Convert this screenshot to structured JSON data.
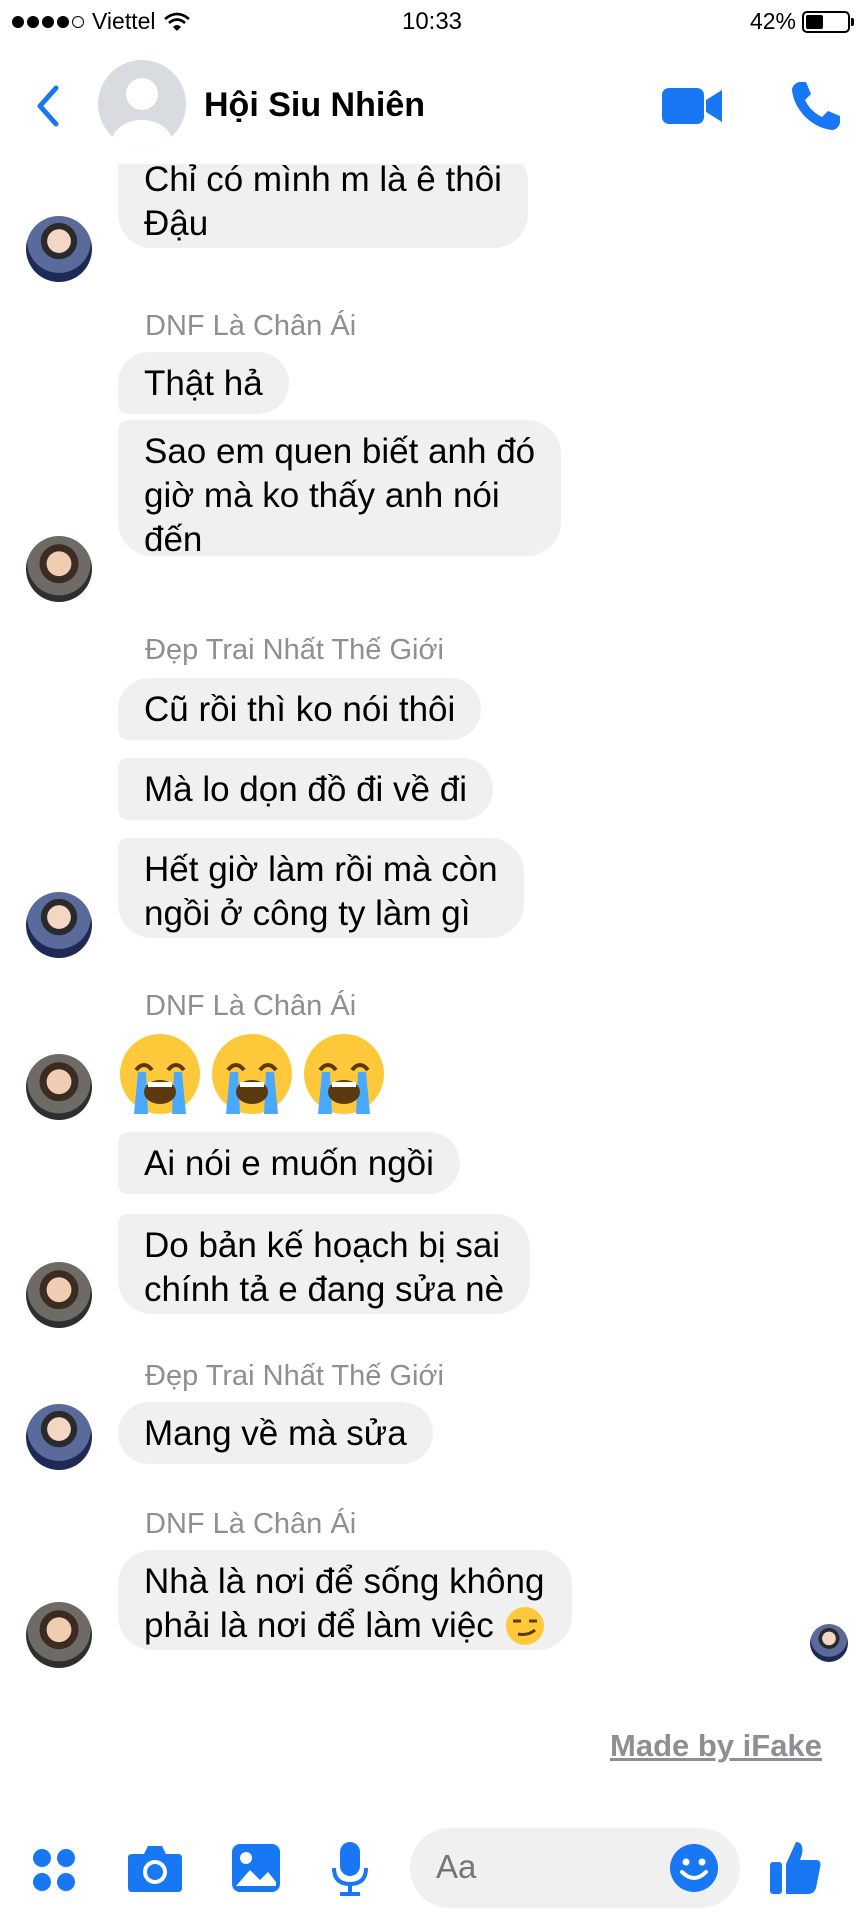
{
  "status_bar": {
    "carrier": "Viettel",
    "time": "10:33",
    "battery": "42%",
    "battery_level": 0.42
  },
  "header": {
    "title": "Hội Siu Nhiên"
  },
  "messages": [
    {
      "sender": "",
      "text_lines": [
        "Chỉ có mình m là ê thôi",
        "Đậu"
      ]
    },
    {
      "sender": "DNF Là Chân Ái",
      "text_lines": [
        "Thật hả"
      ]
    },
    {
      "sender": "",
      "text_lines": [
        "Sao em quen biết anh đó",
        "giờ mà ko thấy anh nói",
        "đến"
      ]
    },
    {
      "sender": "Đẹp Trai Nhất Thế Giới",
      "text_lines": [
        "Cũ rồi thì ko nói thôi"
      ]
    },
    {
      "sender": "",
      "text_lines": [
        "Mà lo dọn đồ đi về đi"
      ]
    },
    {
      "sender": "",
      "text_lines": [
        "Hết giờ làm rồi mà còn",
        "ngồi ở công ty làm gì"
      ]
    },
    {
      "sender": "DNF Là Chân Ái",
      "emojis": [
        "crying-face",
        "crying-face",
        "crying-face"
      ]
    },
    {
      "sender": "",
      "text_lines": [
        "Ai nói e muốn ngồi"
      ]
    },
    {
      "sender": "",
      "text_lines": [
        "Do bản kế hoạch bị sai",
        "chính tả e đang sửa nè"
      ]
    },
    {
      "sender": "Đẹp Trai Nhất Thế Giới",
      "text_lines": [
        "Mang về mà sửa"
      ]
    },
    {
      "sender": "DNF Là Chân Ái",
      "text_lines": [
        "Nhà là nơi để sống không",
        "phải là nơi để làm việc"
      ],
      "trailing_emoji": "smirking-face"
    }
  ],
  "watermark": "Made by iFake",
  "composer": {
    "placeholder": "Aa"
  },
  "colors": {
    "accent": "#1877f2",
    "bubble": "#f0f0f0",
    "sender": "#8e8e93"
  }
}
